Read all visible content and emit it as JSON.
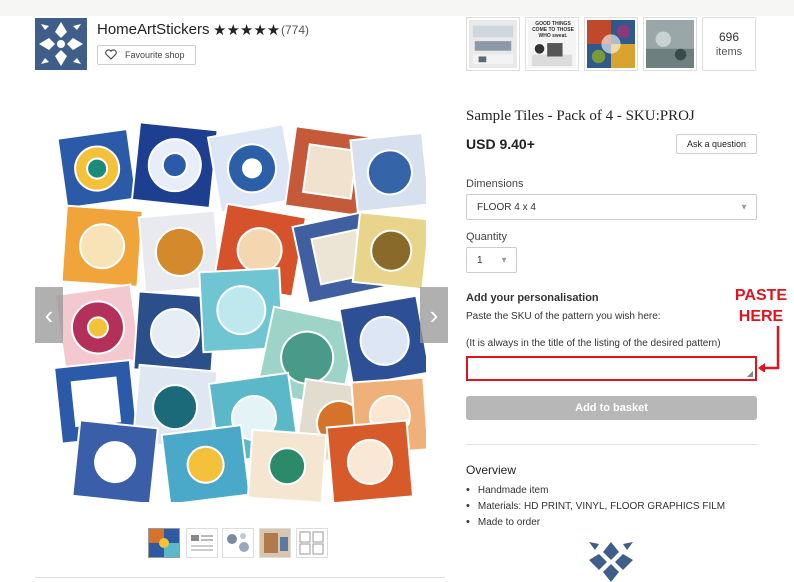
{
  "shop": {
    "name": "HomeArtStickers",
    "stars": "★★★★★",
    "review_count": "(774)",
    "favourite_label": "Favourite shop",
    "items_count": "696",
    "items_label": "items",
    "thumbnail_text": "GOOD THINGS COME TO THOSE WHO sweat."
  },
  "listing": {
    "title": "Sample Tiles - Pack of 4 - SKU:PROJ",
    "price": "USD 9.40+",
    "ask_label": "Ask a question",
    "dimensions_label": "Dimensions",
    "dimensions_value": "FLOOR 4 x 4",
    "quantity_label": "Quantity",
    "quantity_value": "1",
    "personalisation_title": "Add your personalisation",
    "personalisation_line1": "Paste the SKU of the pattern you wish here:",
    "personalisation_line2": "(It is always in the title of the listing of the desired pattern)",
    "add_to_basket": "Add to basket",
    "overview_title": "Overview",
    "overview_items": [
      "Handmade item",
      "Materials: HD PRINT, VINYL, FLOOR GRAPHICS FILM",
      "Made to order"
    ]
  },
  "annotation": {
    "paste_line1": "PASTE",
    "paste_line2": "HERE"
  },
  "colors": {
    "accent_red": "#e0141e",
    "tile_blue": "#3f5f8a",
    "button_grey": "#b7b7b7"
  },
  "icons": {
    "heart": "heart-icon",
    "caret": "chevron-down-icon",
    "prev": "chevron-left-icon",
    "next": "chevron-right-icon"
  }
}
